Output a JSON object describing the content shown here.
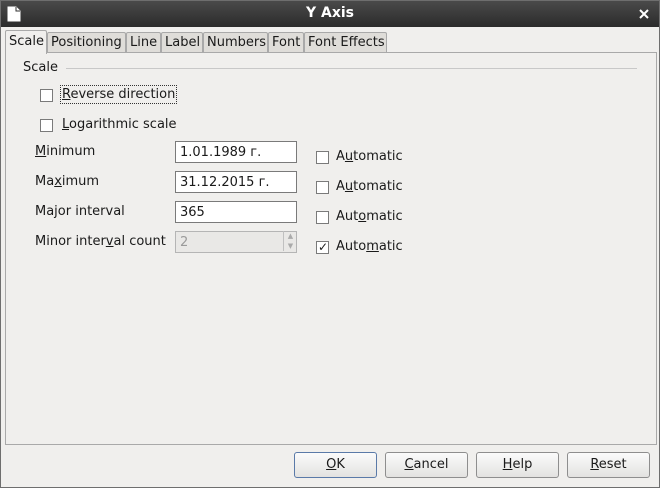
{
  "window": {
    "title": "Y Axis"
  },
  "tabs": [
    {
      "label": "Scale",
      "active": true
    },
    {
      "label": "Positioning"
    },
    {
      "label": "Line"
    },
    {
      "label": "Label"
    },
    {
      "label": "Numbers"
    },
    {
      "label": "Font"
    },
    {
      "label": "Font Effects"
    }
  ],
  "scale": {
    "section_title": "Scale",
    "reverse_direction": {
      "label_pre": "",
      "label_acc": "R",
      "label_post": "everse direction",
      "checked": false
    },
    "logarithmic": {
      "label_pre": "",
      "label_acc": "L",
      "label_post": "ogarithmic scale",
      "checked": false
    },
    "minimum": {
      "label_pre": "",
      "label_acc": "M",
      "label_post": "inimum",
      "value": "1.01.1989 г.",
      "automatic": false
    },
    "maximum": {
      "label_pre": "Ma",
      "label_acc": "x",
      "label_post": "imum",
      "value": "31.12.2015 г.",
      "automatic": false
    },
    "major_interval": {
      "label": "Major interval",
      "value": "365",
      "automatic": false
    },
    "minor_interval_count": {
      "label_pre": "Minor inter",
      "label_acc": "v",
      "label_post": "al count",
      "value": "2",
      "automatic": true
    },
    "automatic_pre": "A",
    "automatic_acc": "u",
    "automatic_post": "tomatic",
    "automatic_alt_pre": "Aut",
    "automatic_alt_acc": "o",
    "automatic_alt_post": "matic",
    "automatic_alt2_pre": "Auto",
    "automatic_alt2_acc": "m",
    "automatic_alt2_post": "atic"
  },
  "buttons": {
    "ok": {
      "acc": "O",
      "rest": "K"
    },
    "cancel": {
      "acc": "C",
      "rest": "ancel"
    },
    "help": {
      "acc": "H",
      "rest": "elp"
    },
    "reset": {
      "acc": "R",
      "rest": "eset"
    }
  }
}
